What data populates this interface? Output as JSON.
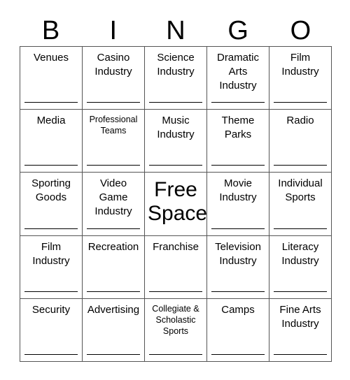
{
  "header": {
    "letters": [
      "B",
      "I",
      "N",
      "G",
      "O"
    ]
  },
  "grid": {
    "rows": 5,
    "columns": 5,
    "border_color": "#555555",
    "signature_line_color": "#000000",
    "background": "#ffffff",
    "text_color": "#000000",
    "cells": [
      {
        "text": "Venues",
        "size": "normal",
        "signature_line": true
      },
      {
        "text": "Casino\nIndustry",
        "size": "normal",
        "signature_line": true
      },
      {
        "text": "Science\nIndustry",
        "size": "normal",
        "signature_line": true
      },
      {
        "text": "Dramatic\nArts\nIndustry",
        "size": "normal",
        "signature_line": true
      },
      {
        "text": "Film\nIndustry",
        "size": "normal",
        "signature_line": true
      },
      {
        "text": "Media",
        "size": "normal",
        "signature_line": true
      },
      {
        "text": "Professional\nTeams",
        "size": "small",
        "signature_line": true
      },
      {
        "text": "Music\nIndustry",
        "size": "normal",
        "signature_line": true
      },
      {
        "text": "Theme\nParks",
        "size": "normal",
        "signature_line": true
      },
      {
        "text": "Radio",
        "size": "normal",
        "signature_line": true
      },
      {
        "text": "Sporting\nGoods",
        "size": "normal",
        "signature_line": true
      },
      {
        "text": "Video\nGame\nIndustry",
        "size": "normal",
        "signature_line": true
      },
      {
        "text": "Free\nSpace",
        "size": "free",
        "signature_line": false
      },
      {
        "text": "Movie\nIndustry",
        "size": "normal",
        "signature_line": true
      },
      {
        "text": "Individual\nSports",
        "size": "normal",
        "signature_line": true
      },
      {
        "text": "Film\nIndustry",
        "size": "normal",
        "signature_line": true
      },
      {
        "text": "Recreation",
        "size": "normal",
        "signature_line": true
      },
      {
        "text": "Franchise",
        "size": "normal",
        "signature_line": true
      },
      {
        "text": "Television\nIndustry",
        "size": "normal",
        "signature_line": true
      },
      {
        "text": "Literacy\nIndustry",
        "size": "normal",
        "signature_line": true
      },
      {
        "text": "Security",
        "size": "normal",
        "signature_line": true
      },
      {
        "text": "Advertising",
        "size": "normal",
        "signature_line": true
      },
      {
        "text": "Collegiate &\nScholastic\nSports",
        "size": "small",
        "signature_line": true
      },
      {
        "text": "Camps",
        "size": "normal",
        "signature_line": true
      },
      {
        "text": "Fine Arts\nIndustry",
        "size": "normal",
        "signature_line": true
      }
    ]
  }
}
